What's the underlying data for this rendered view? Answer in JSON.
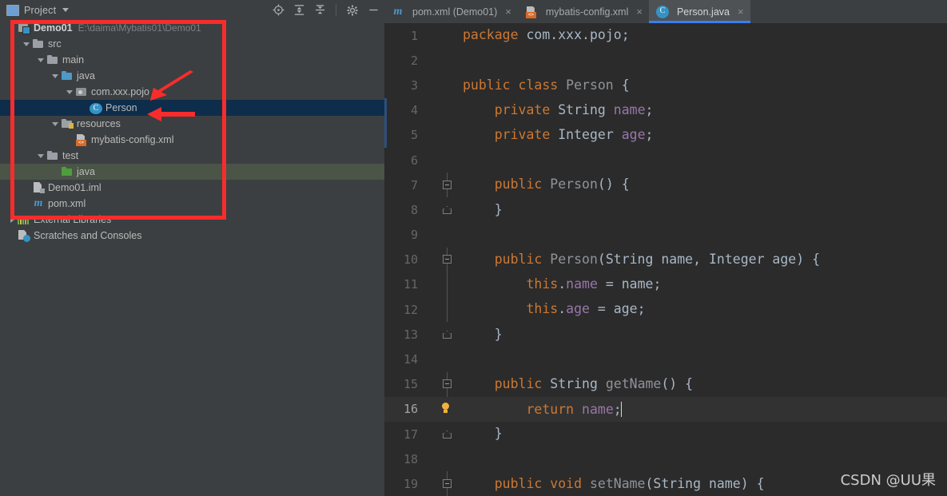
{
  "window": {
    "tool_window_title": "Project",
    "watermark": "CSDN @UU果"
  },
  "colors": {
    "panel_bg": "#3c3f41",
    "editor_bg": "#2b2b2b",
    "selection_blue": "#0d2d4b",
    "test_root_green": "#4a5548",
    "annotation_red": "#f92c2c",
    "tab_accent": "#3a7ff0",
    "keyword_orange": "#cc7832",
    "field_purple": "#9876aa",
    "text_grey": "#a9b7c6"
  },
  "project_header": {
    "title": "Project",
    "icons": [
      {
        "name": "locate-icon",
        "glyph": "⊕"
      },
      {
        "name": "expand-all-icon",
        "glyph": "⤒"
      },
      {
        "name": "collapse-all-icon",
        "glyph": "⤓"
      },
      {
        "name": "settings-gear-icon",
        "glyph": "⚙"
      },
      {
        "name": "minimize-icon",
        "glyph": "—"
      }
    ]
  },
  "tree": {
    "nodes": [
      {
        "label": "Demo01",
        "path": "E:\\daima\\Mybatis01\\Demo01",
        "icon": "module-icon",
        "indent": 0,
        "twist": "none",
        "bold": true,
        "state": "normal"
      },
      {
        "label": "src",
        "path": "",
        "icon": "folder-icon",
        "indent": 1,
        "twist": "open",
        "bold": false,
        "state": "normal"
      },
      {
        "label": "main",
        "path": "",
        "icon": "folder-icon",
        "indent": 2,
        "twist": "open",
        "bold": false,
        "state": "normal"
      },
      {
        "label": "java",
        "path": "",
        "icon": "source-folder-icon",
        "indent": 3,
        "twist": "open",
        "bold": false,
        "state": "normal"
      },
      {
        "label": "com.xxx.pojo",
        "path": "",
        "icon": "package-icon",
        "indent": 4,
        "twist": "open",
        "bold": false,
        "state": "normal"
      },
      {
        "label": "Person",
        "path": "",
        "icon": "java-class-icon",
        "indent": 5,
        "twist": "none",
        "bold": false,
        "state": "selected"
      },
      {
        "label": "resources",
        "path": "",
        "icon": "resources-folder-icon",
        "indent": 3,
        "twist": "open",
        "bold": false,
        "state": "normal"
      },
      {
        "label": "mybatis-config.xml",
        "path": "",
        "icon": "xml-file-icon",
        "indent": 4,
        "twist": "none",
        "bold": false,
        "state": "normal"
      },
      {
        "label": "test",
        "path": "",
        "icon": "folder-icon",
        "indent": 2,
        "twist": "open",
        "bold": false,
        "state": "normal"
      },
      {
        "label": "java",
        "path": "",
        "icon": "test-source-folder-icon",
        "indent": 3,
        "twist": "none",
        "bold": false,
        "state": "testroot"
      },
      {
        "label": "Demo01.iml",
        "path": "",
        "icon": "iml-file-icon",
        "indent": 1,
        "twist": "none",
        "bold": false,
        "state": "normal"
      },
      {
        "label": "pom.xml",
        "path": "",
        "icon": "maven-file-icon",
        "indent": 1,
        "twist": "none",
        "bold": false,
        "state": "normal"
      },
      {
        "label": "External Libraries",
        "path": "",
        "icon": "libraries-icon",
        "indent": 0,
        "twist": "closed",
        "bold": false,
        "state": "normal"
      },
      {
        "label": "Scratches and Consoles",
        "path": "",
        "icon": "scratches-icon",
        "indent": 0,
        "twist": "none",
        "bold": false,
        "state": "normal"
      }
    ]
  },
  "tabs": [
    {
      "label": "pom.xml (Demo01)",
      "icon": "maven-file-icon",
      "active": false,
      "close": "×"
    },
    {
      "label": "mybatis-config.xml",
      "icon": "xml-file-icon",
      "active": false,
      "close": "×"
    },
    {
      "label": "Person.java",
      "icon": "java-class-icon",
      "active": true,
      "close": "×"
    }
  ],
  "editor": {
    "file": "Person.java",
    "caret_line": 16,
    "lines": [
      {
        "no": "1",
        "gutter": "none",
        "marker": "none",
        "current": false,
        "tokens": [
          {
            "t": "package ",
            "c": "kw"
          },
          {
            "t": "com.xxx.pojo;",
            "c": "plain"
          }
        ]
      },
      {
        "no": "2",
        "gutter": "none",
        "marker": "none",
        "current": false,
        "tokens": []
      },
      {
        "no": "3",
        "gutter": "none",
        "marker": "none",
        "current": false,
        "tokens": [
          {
            "t": "public class ",
            "c": "kw"
          },
          {
            "t": "Person ",
            "c": "clsdef"
          },
          {
            "t": "{",
            "c": "plain"
          }
        ]
      },
      {
        "no": "4",
        "gutter": "none",
        "marker": "blue",
        "current": false,
        "tokens": [
          {
            "t": "    private ",
            "c": "kw"
          },
          {
            "t": "String ",
            "c": "plain"
          },
          {
            "t": "name",
            "c": "field"
          },
          {
            "t": ";",
            "c": "plain"
          }
        ]
      },
      {
        "no": "5",
        "gutter": "none",
        "marker": "blue",
        "current": false,
        "tokens": [
          {
            "t": "    private ",
            "c": "kw"
          },
          {
            "t": "Integer ",
            "c": "plain"
          },
          {
            "t": "age",
            "c": "field"
          },
          {
            "t": ";",
            "c": "plain"
          }
        ]
      },
      {
        "no": "6",
        "gutter": "none",
        "marker": "none",
        "current": false,
        "tokens": []
      },
      {
        "no": "7",
        "gutter": "fold",
        "marker": "none",
        "current": false,
        "tokens": [
          {
            "t": "    public ",
            "c": "kw"
          },
          {
            "t": "Person",
            "c": "clsdef"
          },
          {
            "t": "() {",
            "c": "plain"
          }
        ]
      },
      {
        "no": "8",
        "gutter": "foldend",
        "marker": "none",
        "current": false,
        "tokens": [
          {
            "t": "    }",
            "c": "plain"
          }
        ]
      },
      {
        "no": "9",
        "gutter": "none",
        "marker": "none",
        "current": false,
        "tokens": []
      },
      {
        "no": "10",
        "gutter": "fold",
        "marker": "none",
        "current": false,
        "tokens": [
          {
            "t": "    public ",
            "c": "kw"
          },
          {
            "t": "Person",
            "c": "clsdef"
          },
          {
            "t": "(String name, Integer age) {",
            "c": "plain"
          }
        ]
      },
      {
        "no": "11",
        "gutter": "foldline",
        "marker": "none",
        "current": false,
        "tokens": [
          {
            "t": "        this",
            "c": "kw"
          },
          {
            "t": ".",
            "c": "plain"
          },
          {
            "t": "name",
            "c": "field"
          },
          {
            "t": " = name;",
            "c": "plain"
          }
        ]
      },
      {
        "no": "12",
        "gutter": "foldline",
        "marker": "none",
        "current": false,
        "tokens": [
          {
            "t": "        this",
            "c": "kw"
          },
          {
            "t": ".",
            "c": "plain"
          },
          {
            "t": "age",
            "c": "field"
          },
          {
            "t": " = age;",
            "c": "plain"
          }
        ]
      },
      {
        "no": "13",
        "gutter": "foldend",
        "marker": "none",
        "current": false,
        "tokens": [
          {
            "t": "    }",
            "c": "plain"
          }
        ]
      },
      {
        "no": "14",
        "gutter": "none",
        "marker": "none",
        "current": false,
        "tokens": []
      },
      {
        "no": "15",
        "gutter": "fold",
        "marker": "none",
        "current": false,
        "tokens": [
          {
            "t": "    public ",
            "c": "kw"
          },
          {
            "t": "String ",
            "c": "plain"
          },
          {
            "t": "getName",
            "c": "mthd"
          },
          {
            "t": "() {",
            "c": "plain"
          }
        ]
      },
      {
        "no": "16",
        "gutter": "bulb",
        "marker": "none",
        "current": true,
        "tokens": [
          {
            "t": "        return ",
            "c": "kw"
          },
          {
            "t": "name",
            "c": "field"
          },
          {
            "t": ";",
            "c": "plain"
          }
        ],
        "caret": true
      },
      {
        "no": "17",
        "gutter": "foldend",
        "marker": "none",
        "current": false,
        "tokens": [
          {
            "t": "    }",
            "c": "plain"
          }
        ]
      },
      {
        "no": "18",
        "gutter": "none",
        "marker": "none",
        "current": false,
        "tokens": []
      },
      {
        "no": "19",
        "gutter": "fold",
        "marker": "none",
        "current": false,
        "tokens": [
          {
            "t": "    public void ",
            "c": "kw"
          },
          {
            "t": "setName",
            "c": "mthd"
          },
          {
            "t": "(String name) {",
            "c": "plain"
          }
        ]
      }
    ]
  },
  "annotations": {
    "rect_label": "highlight-rectangle-project-tree",
    "arrows": [
      {
        "name": "arrow-to-package",
        "direction": "down-left",
        "target": "com.xxx.pojo"
      },
      {
        "name": "arrow-to-person-class",
        "direction": "left",
        "target": "Person"
      }
    ]
  }
}
